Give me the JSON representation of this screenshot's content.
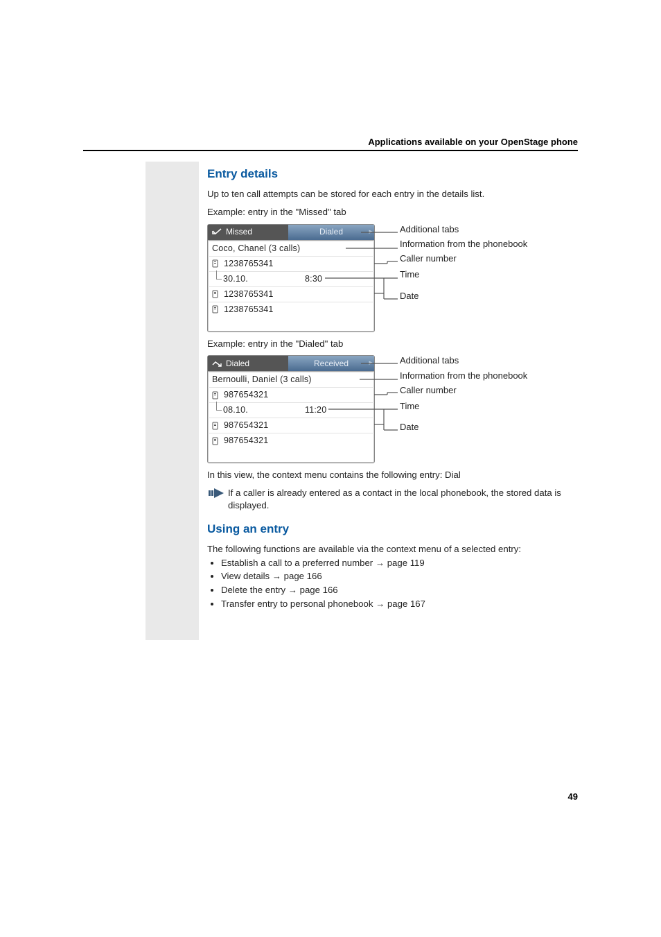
{
  "header_text": "Applications available on your OpenStage phone",
  "section1_title": "Entry details",
  "section1_intro1": "Up to ten call attempts can be stored for each entry in the details list.",
  "section1_intro2": "Example: entry in the \"Missed\" tab",
  "missed_diag": {
    "tab_active": "Missed",
    "tab_inactive": "Dialed",
    "info_line": "Coco, Chanel (3 calls)",
    "num1": "1238765341",
    "date": "30.10.",
    "time": "8:30",
    "num2": "1238765341",
    "num3": "1238765341"
  },
  "callout_labels": {
    "tabs": "Additional tabs",
    "info": "Information from the phonebook",
    "number": "Caller number",
    "time": "Time",
    "date": "Date"
  },
  "section1_intro3": "Example: entry in the \"Dialed\" tab",
  "dialed_diag": {
    "tab_active": "Dialed",
    "tab_inactive": "Received",
    "info_line": "Bernoulli, Daniel (3 calls)",
    "num1": "987654321",
    "date": "08.10.",
    "time": "11:20",
    "num2": "987654321",
    "num3": "987654321"
  },
  "section1_post1": "In this view, the context menu contains the following entry: Dial",
  "note_text": "If a caller is already entered as a contact in the local phonebook, the stored data is displayed.",
  "section2_title": "Using an entry",
  "section2_intro": "The following functions are available via the context menu of a selected entry:",
  "list": {
    "i1a": "Establish a call to a preferred number ",
    "i1b": " page 119",
    "i2a": "View details ",
    "i2b": " page 166",
    "i3a": "Delete the entry ",
    "i3b": " page 166",
    "i4a": "Transfer entry to personal phonebook ",
    "i4b": " page 167"
  },
  "arrow": "→",
  "page_number": "49"
}
